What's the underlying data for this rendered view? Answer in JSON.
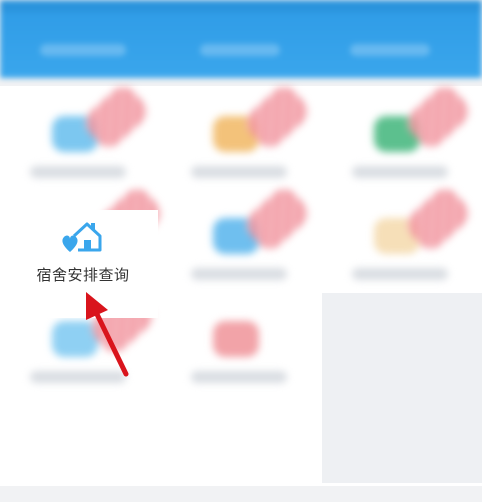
{
  "header": {
    "title": ""
  },
  "featured": {
    "label": "宿舍安排查询",
    "icon": "house-heart-icon"
  },
  "colors": {
    "header": "#3aa6ec",
    "icon_accent": "#3aa6ec",
    "arrow": "#d9141c"
  }
}
